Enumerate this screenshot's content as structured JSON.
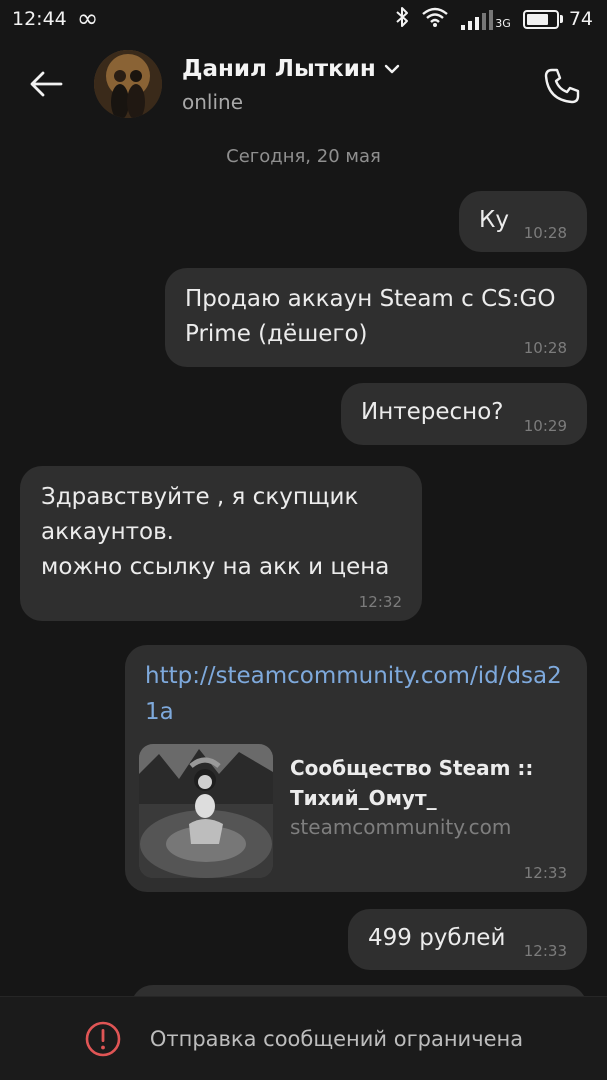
{
  "status_bar": {
    "time": "12:44",
    "infinity_glyph": "∞",
    "network_type": "3G",
    "battery_level": "74",
    "battery_fraction": 0.74,
    "icons": [
      "infinity-icon",
      "bluetooth-icon",
      "wifi-icon",
      "signal-icon",
      "battery-icon"
    ]
  },
  "header": {
    "contact_name": "Данил Лыткин",
    "contact_status": "online",
    "icons": [
      "back-arrow-icon",
      "chevron-down-icon",
      "phone-icon"
    ]
  },
  "date_separator": "Сегодня, 20 мая",
  "messages": [
    {
      "direction": "outgoing",
      "text": "Ку",
      "time": "10:28"
    },
    {
      "direction": "outgoing",
      "text": "Продаю аккаун Steam с CS:GO Prime (дёшего)",
      "time": "10:28"
    },
    {
      "direction": "outgoing",
      "text": "Интересно?",
      "time": "10:29"
    },
    {
      "direction": "incoming",
      "text": "Здравствуйте , я скупщик аккаунтов.\nможно ссылку на акк и цена",
      "time": "12:32"
    },
    {
      "direction": "outgoing",
      "link": "http://steamcommunity.com/id/dsa21a",
      "preview_title": "Сообщество Steam :: Тихий_Омут_",
      "preview_domain": "steamcommunity.com",
      "time": "12:33"
    },
    {
      "direction": "outgoing",
      "text": "499 рублей",
      "time": "12:33"
    }
  ],
  "bottom_bar": {
    "text": "Отправка сообщений ограничена",
    "icon": "warning-circle-icon",
    "accent_color": "#e05555"
  },
  "colors": {
    "background": "#161616",
    "bubble": "#2f2f2f",
    "link": "#7ea9dc"
  }
}
